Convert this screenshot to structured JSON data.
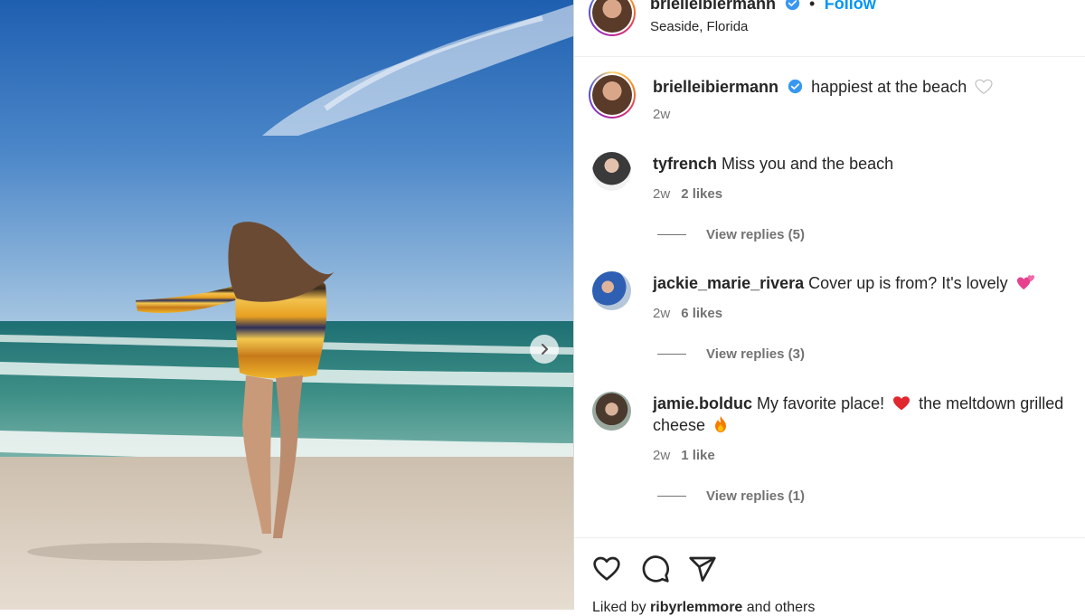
{
  "post": {
    "username": "brielleibiermann",
    "follow_label": "Follow",
    "location": "Seaside, Florida",
    "caption": "happiest at the beach",
    "caption_time": "2w"
  },
  "comments": [
    {
      "username": "tyfrench",
      "text": "Miss you and the beach",
      "time": "2w",
      "likes": "2 likes",
      "replies": "View replies (5)"
    },
    {
      "username": "jackie_marie_rivera",
      "text": "Cover up is from? It's lovely",
      "time": "2w",
      "likes": "6 likes",
      "replies": "View replies (3)"
    },
    {
      "username": "jamie.bolduc",
      "text": "My favorite place!",
      "text2": "the meltdown grilled cheese",
      "time": "2w",
      "likes": "1 like",
      "replies": "View replies (1)"
    }
  ],
  "footer": {
    "liked_by_prefix": "Liked by",
    "liked_by_user": "ribyrlemmore",
    "liked_by_suffix": "and others"
  },
  "icons": {
    "verified": "verified-badge-icon",
    "heart": "heart-icon",
    "comment": "comment-icon",
    "share": "share-icon",
    "next": "chevron-right-icon"
  },
  "colors": {
    "link_blue": "#0095f6",
    "verified_blue": "#3897f0",
    "text": "#262626",
    "muted": "#737373"
  }
}
